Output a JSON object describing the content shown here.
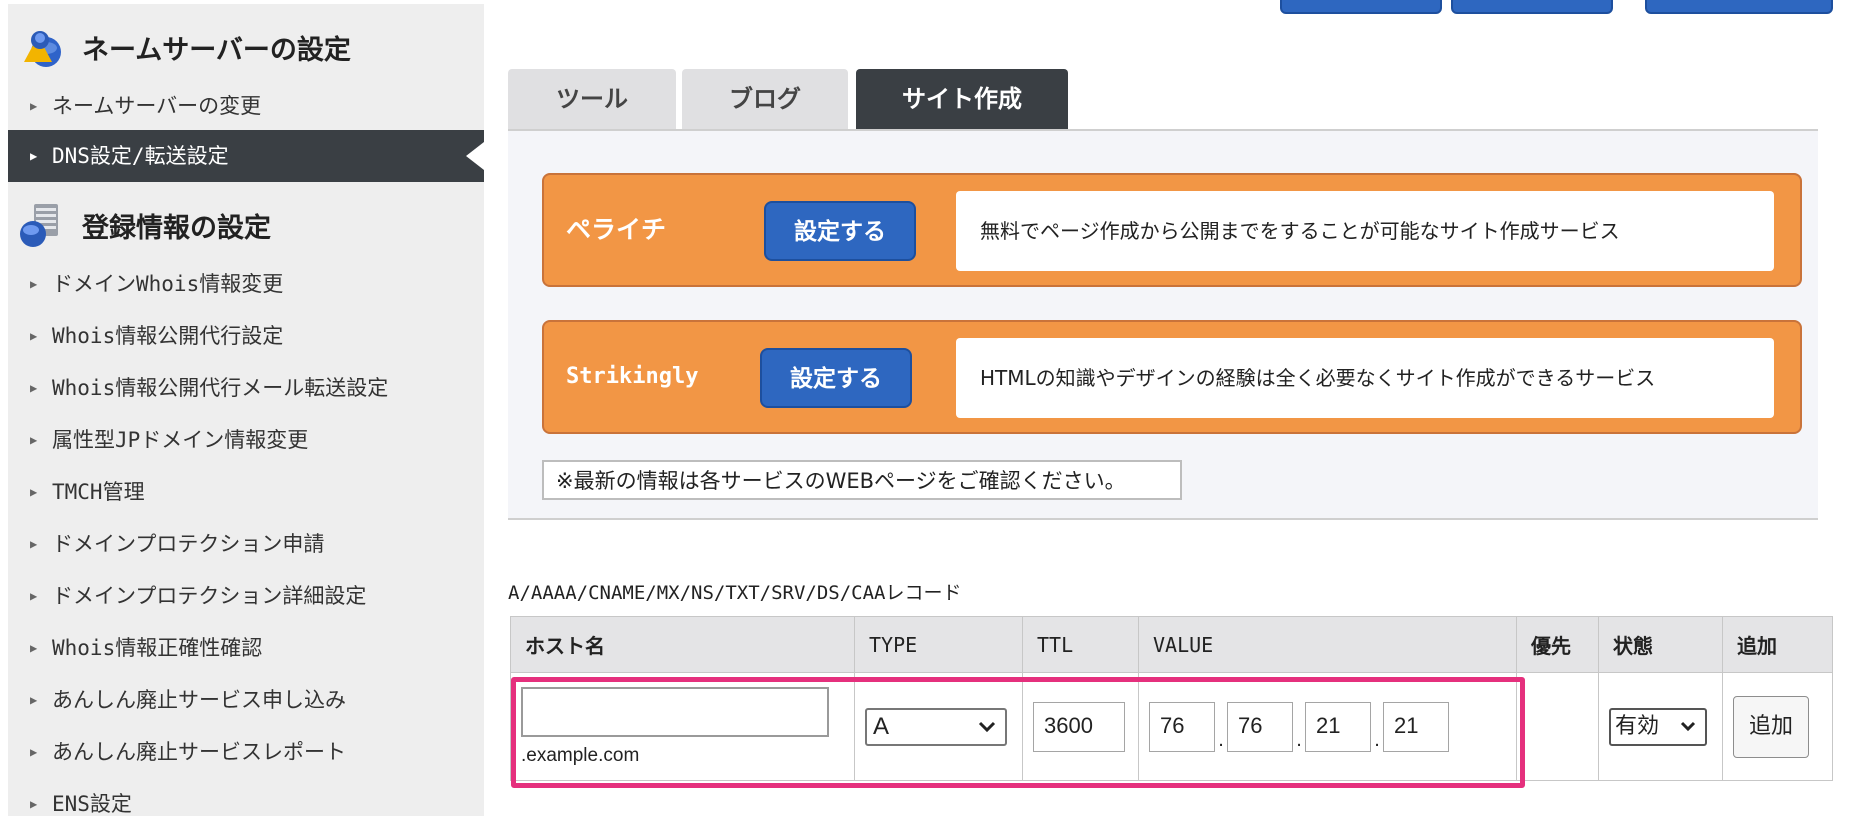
{
  "sidebar": {
    "sections": [
      {
        "title": "ネームサーバーの設定",
        "icon": "globe-user-icon",
        "items": [
          "ネームサーバーの変更",
          "DNS設定/転送設定"
        ]
      },
      {
        "title": "登録情報の設定",
        "icon": "document-globe-icon",
        "items": [
          "ドメインWhois情報変更",
          "Whois情報公開代行設定",
          "Whois情報公開代行メール転送設定",
          "属性型JPドメイン情報変更",
          "TMCH管理",
          "ドメインプロテクション申請",
          "ドメインプロテクション詳細設定",
          "Whois情報正確性確認",
          "あんしん廃止サービス申し込み",
          "あんしん廃止サービスレポート",
          "ENS設定"
        ]
      }
    ],
    "active_item": "DNS設定/転送設定"
  },
  "tabs": {
    "items": [
      "ツール",
      "ブログ",
      "サイト作成"
    ],
    "active": "サイト作成"
  },
  "services": [
    {
      "name": "ペライチ",
      "button": "設定する",
      "description": "無料でページ作成から公開までをすることが可能なサイト作成サービス"
    },
    {
      "name": "Strikingly",
      "button": "設定する",
      "description": "HTMLの知識やデザインの経験は全く必要なくサイト作成ができるサービス"
    }
  ],
  "note": "※最新の情報は各サービスのWEBページをご確認ください。",
  "records": {
    "title": "A/AAAA/CNAME/MX/NS/TXT/SRV/DS/CAAレコード",
    "columns": [
      "ホスト名",
      "TYPE",
      "TTL",
      "VALUE",
      "優先",
      "状態",
      "追加"
    ],
    "row": {
      "host": "",
      "domain_suffix": ".example.com",
      "type": "A",
      "ttl": "3600",
      "value_octets": [
        "76",
        "76",
        "21",
        "21"
      ],
      "priority": "",
      "status": "有効",
      "add_label": "追加"
    }
  },
  "colors": {
    "accent_blue": "#2e67c0",
    "orange": "#f29645",
    "dark": "#3a3f44",
    "highlight": "#e5307d"
  }
}
